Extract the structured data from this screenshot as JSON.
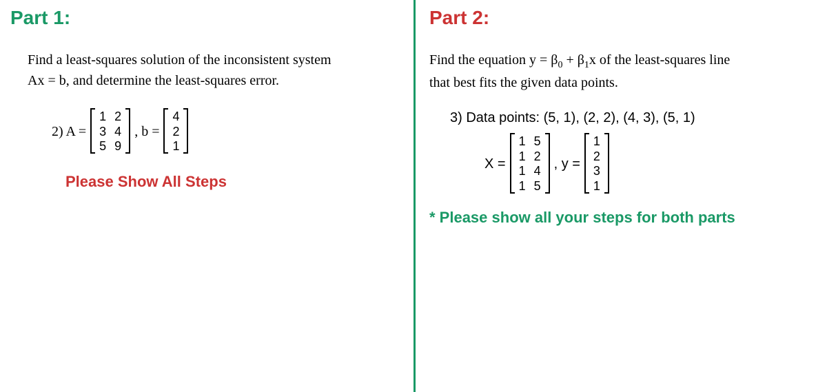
{
  "part1": {
    "title": "Part 1:",
    "instruction_line1": "Find a least-squares solution of the inconsistent system",
    "instruction_line2": "Ax = b, and determine the least-squares error.",
    "problem_number": "2) A =",
    "matrix_A": [
      [
        "1",
        "2"
      ],
      [
        "3",
        "4"
      ],
      [
        "5",
        "9"
      ]
    ],
    "b_label": ", b =",
    "vector_b": [
      [
        "4"
      ],
      [
        "2"
      ],
      [
        "1"
      ]
    ],
    "show_steps": "Please Show All Steps"
  },
  "part2": {
    "title": "Part 2:",
    "instruction_line1": "Find the equation y = β",
    "sub0": "0",
    "instruction_mid": " + β",
    "sub1": "1",
    "instruction_line1_end": "x of the least-squares line",
    "instruction_line2": "that best fits the given data points.",
    "problem_number": "3)",
    "data_points_label": "Data points: (5, 1), (2, 2), (4, 3), (5, 1)",
    "x_label": "X =",
    "matrix_X": [
      [
        "1",
        "5"
      ],
      [
        "1",
        "2"
      ],
      [
        "1",
        "4"
      ],
      [
        "1",
        "5"
      ]
    ],
    "y_label": ", y =",
    "vector_y": [
      [
        "1"
      ],
      [
        "2"
      ],
      [
        "3"
      ],
      [
        "1"
      ]
    ],
    "show_steps": "* Please show all  your steps for both parts"
  }
}
